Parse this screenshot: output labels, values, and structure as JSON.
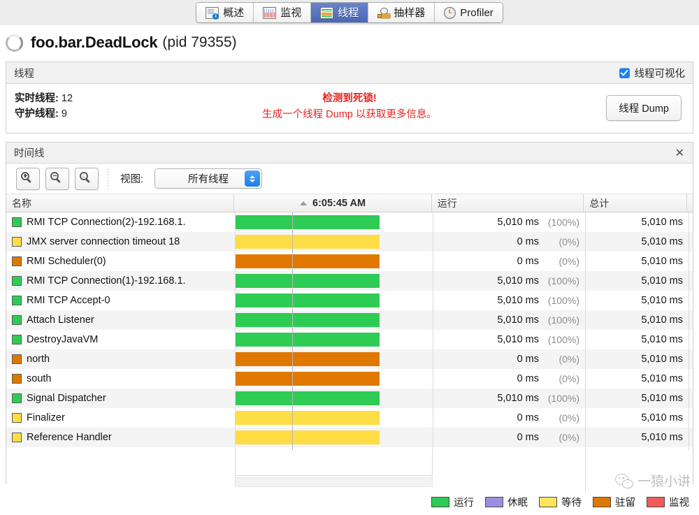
{
  "tabs": [
    {
      "label": "概述",
      "icon": "overview-doc-icon",
      "active": false
    },
    {
      "label": "监视",
      "icon": "monitor-chart-icon",
      "active": false
    },
    {
      "label": "线程",
      "icon": "threads-bars-icon",
      "active": true
    },
    {
      "label": "抽样器",
      "icon": "sampler-gauge-icon",
      "active": false
    },
    {
      "label": "Profiler",
      "icon": "profiler-clock-icon",
      "active": false
    }
  ],
  "title": {
    "icon": "loading-spinner-icon",
    "main": "foo.bar.DeadLock",
    "sub": "(pid 79355)"
  },
  "threads_panel": {
    "header_title": "线程",
    "visualize_checkbox_label": "线程可视化",
    "visualize_checked": true,
    "live_threads_label": "实时线程:",
    "live_threads_value": "12",
    "daemon_threads_label": "守护线程:",
    "daemon_threads_value": "9",
    "deadlock_line1": "检测到死锁!",
    "deadlock_line2": "生成一个线程 Dump 以获取更多信息。",
    "deadlock_color": "#e8241f",
    "dump_button_label": "线程 Dump"
  },
  "timeline_panel": {
    "header_title": "时间线",
    "close_icon": "close-icon",
    "zoom_in_icon": "zoom-in-icon",
    "zoom_out_icon": "zoom-out-icon",
    "zoom_fit_icon": "zoom-fit-icon",
    "view_label": "视图:",
    "view_value": "所有线程",
    "view_options": [
      "所有线程"
    ]
  },
  "table": {
    "columns": {
      "name": "名称",
      "time": "6:05:45 AM",
      "running": "运行",
      "total": "总计"
    },
    "sort_indicator": "sort-ascending-caret",
    "rows": [
      {
        "name": "RMI TCP Connection(2)-192.168.1.",
        "state_color": "#2ecc54",
        "bar_color": "#2ecc54",
        "running": "5,010 ms",
        "pct": "(100%)",
        "total": "5,010 ms"
      },
      {
        "name": "JMX server connection timeout 18",
        "state_color": "#ffdd44",
        "bar_color": "#ffdd44",
        "running": "0 ms",
        "pct": "(0%)",
        "total": "5,010 ms"
      },
      {
        "name": "RMI Scheduler(0)",
        "state_color": "#e07800",
        "bar_color": "#e07800",
        "running": "0 ms",
        "pct": "(0%)",
        "total": "5,010 ms"
      },
      {
        "name": "RMI TCP Connection(1)-192.168.1.",
        "state_color": "#2ecc54",
        "bar_color": "#2ecc54",
        "running": "5,010 ms",
        "pct": "(100%)",
        "total": "5,010 ms"
      },
      {
        "name": "RMI TCP Accept-0",
        "state_color": "#2ecc54",
        "bar_color": "#2ecc54",
        "running": "5,010 ms",
        "pct": "(100%)",
        "total": "5,010 ms"
      },
      {
        "name": "Attach Listener",
        "state_color": "#2ecc54",
        "bar_color": "#2ecc54",
        "running": "5,010 ms",
        "pct": "(100%)",
        "total": "5,010 ms"
      },
      {
        "name": "DestroyJavaVM",
        "state_color": "#2ecc54",
        "bar_color": "#2ecc54",
        "running": "5,010 ms",
        "pct": "(100%)",
        "total": "5,010 ms"
      },
      {
        "name": "north",
        "state_color": "#e07800",
        "bar_color": "#e07800",
        "running": "0 ms",
        "pct": "(0%)",
        "total": "5,010 ms"
      },
      {
        "name": "south",
        "state_color": "#e07800",
        "bar_color": "#e07800",
        "running": "0 ms",
        "pct": "(0%)",
        "total": "5,010 ms"
      },
      {
        "name": "Signal Dispatcher",
        "state_color": "#2ecc54",
        "bar_color": "#2ecc54",
        "running": "5,010 ms",
        "pct": "(100%)",
        "total": "5,010 ms"
      },
      {
        "name": "Finalizer",
        "state_color": "#ffdd44",
        "bar_color": "#ffdd44",
        "running": "0 ms",
        "pct": "(0%)",
        "total": "5,010 ms"
      },
      {
        "name": "Reference Handler",
        "state_color": "#ffdd44",
        "bar_color": "#ffdd44",
        "running": "0 ms",
        "pct": "(0%)",
        "total": "5,010 ms"
      }
    ]
  },
  "legend": [
    {
      "label": "运行",
      "color": "#2ecc54"
    },
    {
      "label": "休眠",
      "color": "#9a8ee0"
    },
    {
      "label": "等待",
      "color": "#ffe45c"
    },
    {
      "label": "驻留",
      "color": "#e07800"
    },
    {
      "label": "监视",
      "color": "#f05a5a"
    }
  ],
  "watermark": {
    "icon": "wechat-icon",
    "text": "一猿小讲"
  }
}
